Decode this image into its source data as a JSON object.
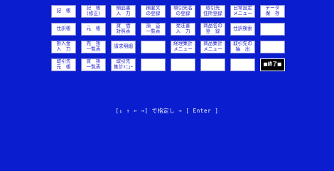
{
  "menu": {
    "rows": [
      [
        {
          "line1": "記　帳",
          "line2": ""
        },
        {
          "line1": "記　帳",
          "line2": "(修正)"
        },
        {
          "line1": "納品書",
          "line2": "入　力"
        },
        {
          "line1": "摘要文",
          "line2": "の登録"
        },
        {
          "line1": "取引先名",
          "line2": "の登録"
        },
        {
          "line1": "取引先",
          "line2": "住所登録"
        },
        {
          "line1": "日常設定",
          "line2": "メニュー"
        },
        {
          "line1": "データ",
          "line2": "保　存"
        }
      ],
      [
        {
          "line1": "仕訳帳",
          "line2": ""
        },
        {
          "line1": "元　帳",
          "line2": ""
        },
        {
          "line1": "貸　借",
          "line2": "対照表"
        },
        {
          "line1": "損　益",
          "line2": "一覧表"
        },
        {
          "line1": "発注書",
          "line2": "入　力"
        },
        {
          "line1": "商品名の",
          "line2": "登　録"
        },
        {
          "line1": "仕訳検索",
          "line2": ""
        },
        {
          "line1": "",
          "line2": ""
        }
      ],
      [
        {
          "line1": "掛入金",
          "line2": "入　力"
        },
        {
          "line1": "売　掛",
          "line2": "一覧表"
        },
        {
          "line1": "請求明細",
          "line2": ""
        },
        {
          "line1": "",
          "line2": ""
        },
        {
          "line1": "経理集計",
          "line2": "メニュー"
        },
        {
          "line1": "商品集計",
          "line2": "メニュー"
        },
        {
          "line1": "取引先の",
          "line2": "抽　出"
        },
        {
          "line1": "",
          "line2": ""
        }
      ],
      [
        {
          "line1": "取引先",
          "line2": "元　帳"
        },
        {
          "line1": "買　掛",
          "line2": "一覧表"
        },
        {
          "line1": "取引先",
          "line2": "集計ﾒﾆｭｰ"
        },
        {
          "line1": "",
          "line2": ""
        },
        {
          "line1": "",
          "line2": ""
        },
        {
          "line1": "",
          "line2": ""
        },
        {
          "line1": "",
          "line2": ""
        },
        {
          "line1": "■終了■",
          "line2": "",
          "selected": true
        }
      ]
    ]
  },
  "hint_text": "[↓ ↑ ← →] で指定し → [ Enter ]",
  "colors": {
    "background": "#0a1ecf",
    "button_bg": "#ffffff",
    "button_text": "#1a1ad0",
    "selected_bg": "#000000",
    "selected_text": "#ffffff"
  }
}
